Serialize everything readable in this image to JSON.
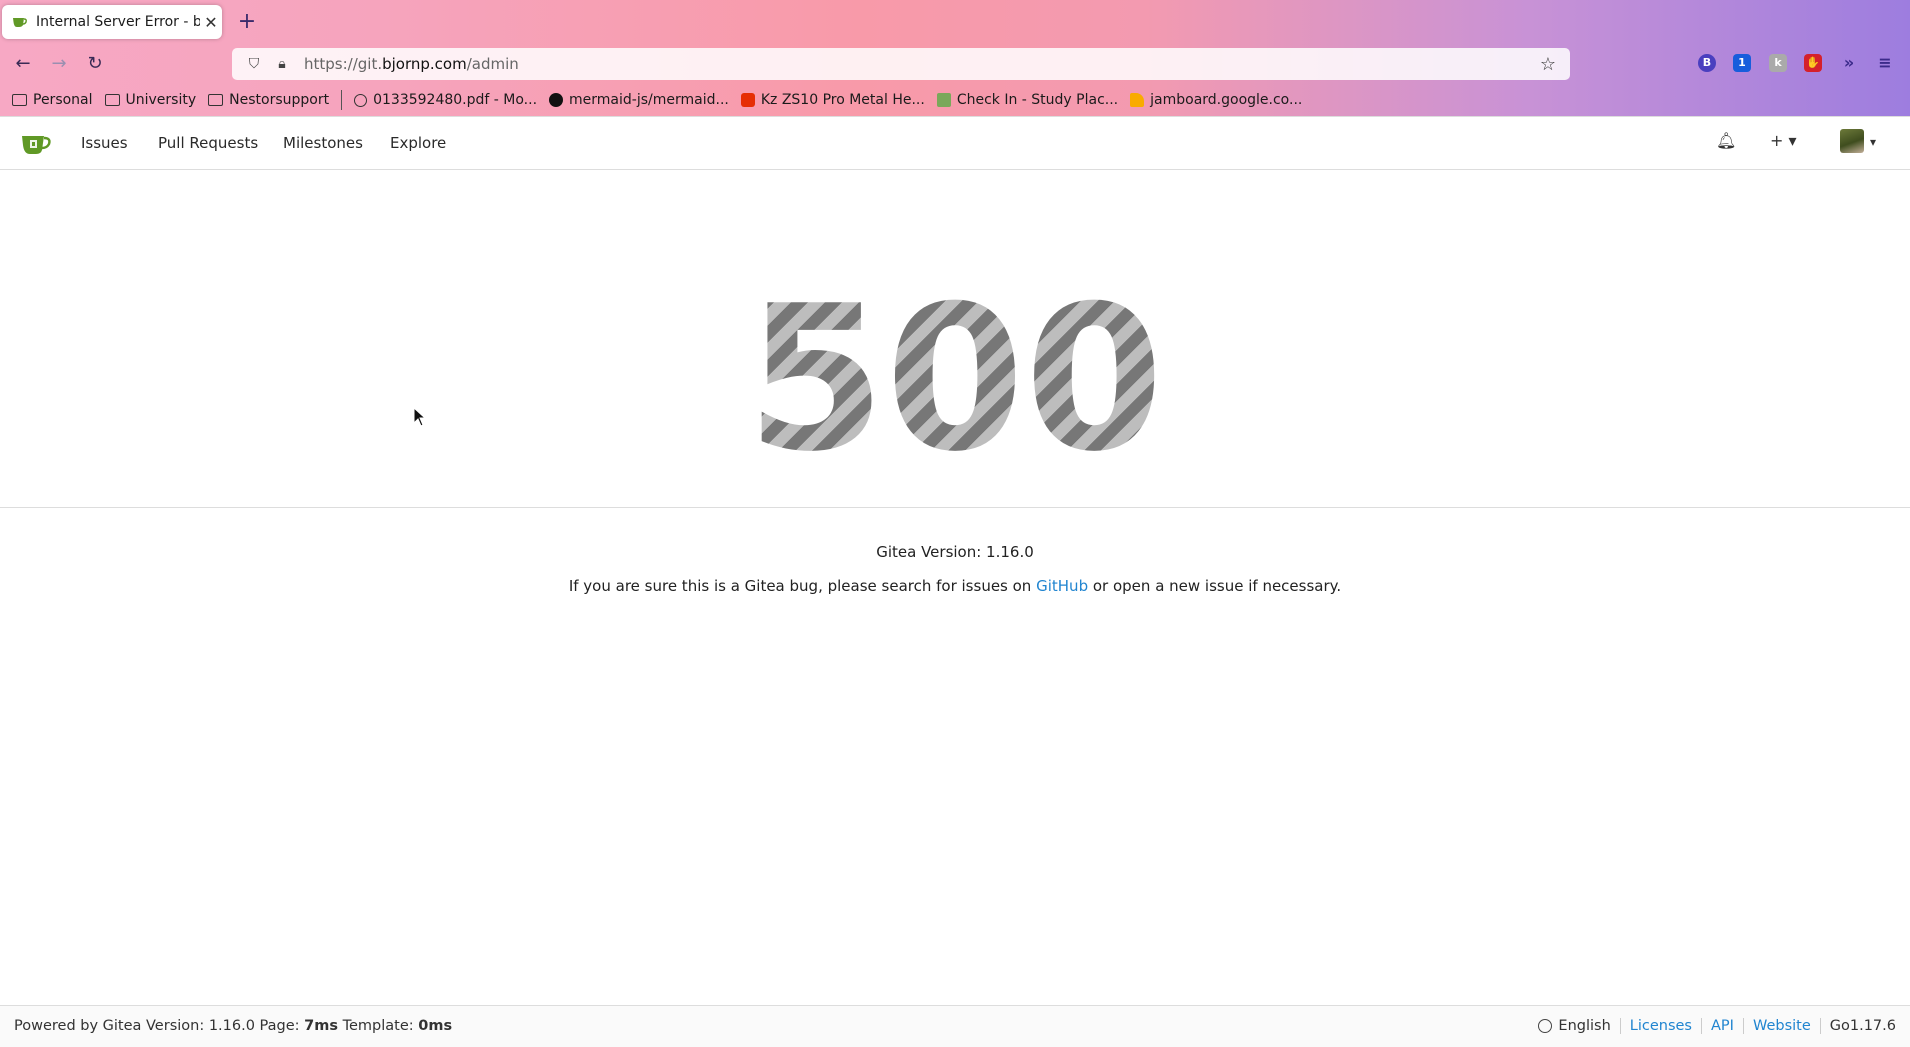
{
  "browser": {
    "tab_title": "Internal Server Error - bjornp",
    "url_prefix": "https://git.",
    "url_domain": "bjornp.com",
    "url_path": "/admin",
    "bookmarks": [
      {
        "label": "Personal",
        "icon": "folder-icon"
      },
      {
        "label": "University",
        "icon": "folder-icon"
      },
      {
        "label": "Nestorsupport",
        "icon": "folder-icon"
      },
      {
        "label": "0133592480.pdf - Mo...",
        "icon": "globe-icon"
      },
      {
        "label": "mermaid-js/mermaid...",
        "icon": "github-icon"
      },
      {
        "label": "Kz ZS10 Pro Metal He...",
        "icon": "store-icon"
      },
      {
        "label": "Check In - Study Plac...",
        "icon": "calendar-icon"
      },
      {
        "label": "jamboard.google.co...",
        "icon": "jamboard-icon"
      }
    ],
    "extension_badge": "1"
  },
  "header": {
    "menu": [
      "Issues",
      "Pull Requests",
      "Milestones",
      "Explore"
    ]
  },
  "main": {
    "error_code": "500",
    "version_text": "Gitea Version: 1.16.0",
    "help_prefix": "If you are sure this is a Gitea bug, please search for issues on",
    "help_link": "GitHub",
    "help_suffix": "or open a new issue if necessary."
  },
  "footer": {
    "powered_prefix": "Powered by Gitea Version: 1.16.0 Page:",
    "page_time": "7ms",
    "template_label": "Template:",
    "template_time": "0ms",
    "language": "English",
    "links": [
      "Licenses",
      "API",
      "Website"
    ],
    "go_version": "Go1.17.6"
  },
  "colors": {
    "link": "#2185d0",
    "gitea_green": "#609926"
  }
}
